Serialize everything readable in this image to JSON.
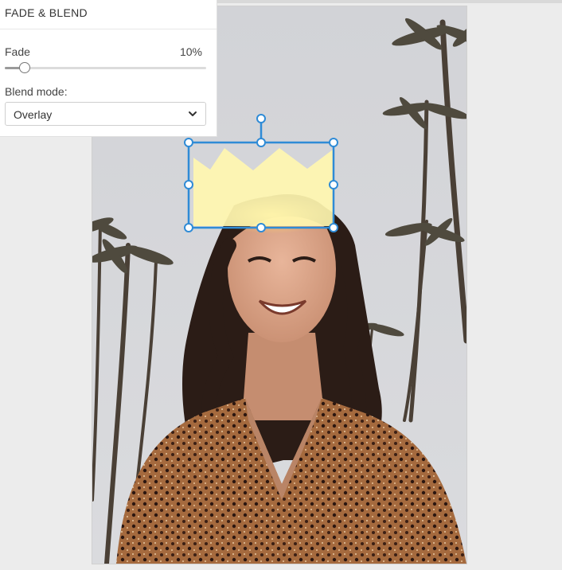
{
  "panel": {
    "title": "FADE & BLEND",
    "fade_label": "Fade",
    "fade_value": "10%",
    "fade_level": 0.1,
    "blend_label": "Blend mode:",
    "blend_value": "Overlay"
  },
  "canvas": {
    "photo": "smiling-woman-palm-trees-photo",
    "sticker": "crown-sticker"
  },
  "colors": {
    "selection": "#2f8bd6",
    "crown": "#fff6b0",
    "sky": "#d6d7db"
  },
  "icons": {
    "dropdown": "chevron-down-icon",
    "rotate": "rotate-handle-icon"
  }
}
